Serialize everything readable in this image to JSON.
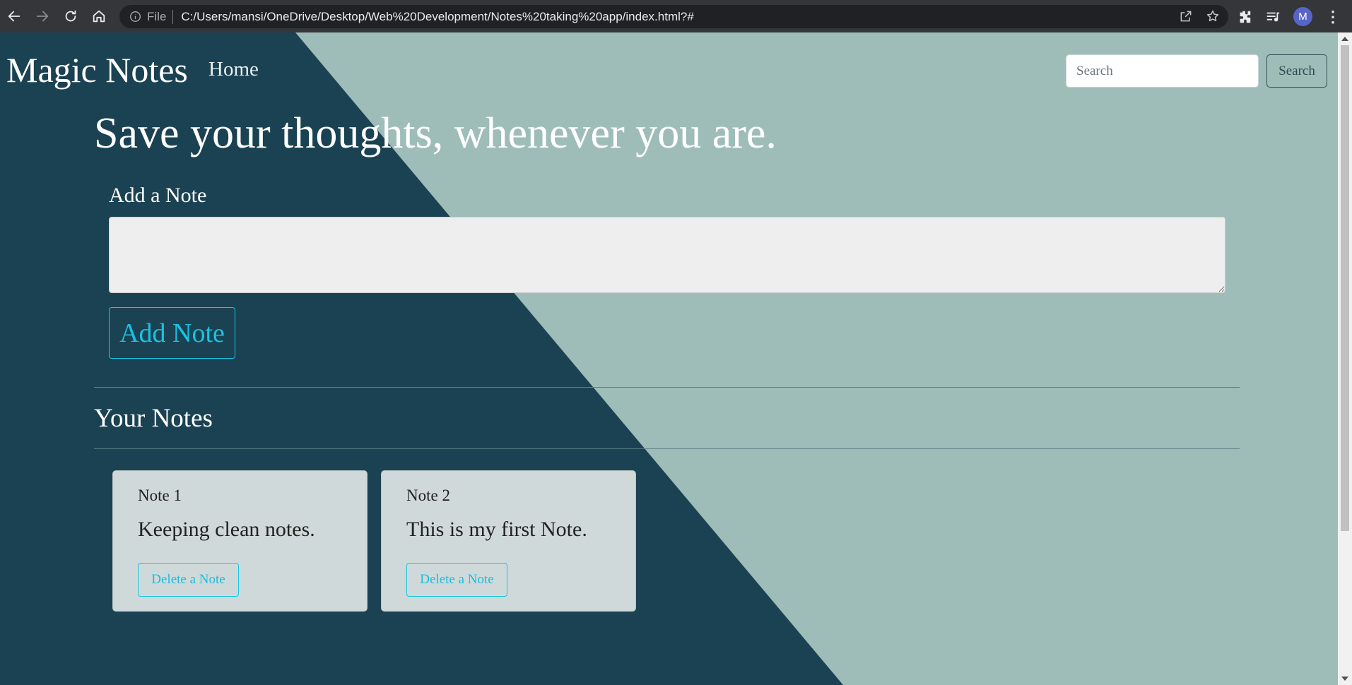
{
  "browser": {
    "file_label": "File",
    "url": "C:/Users/mansi/OneDrive/Desktop/Web%20Development/Notes%20taking%20app/index.html?#",
    "profile_initial": "M"
  },
  "nav": {
    "brand": "Magic Notes",
    "home": "Home",
    "search_placeholder": "Search",
    "search_button": "Search"
  },
  "main": {
    "headline": "Save your thoughts, whenever you are.",
    "add_label": "Add a Note",
    "add_button": "Add Note",
    "notes_heading": "Your Notes"
  },
  "notes": [
    {
      "title": "Note 1",
      "text": "Keeping clean notes.",
      "delete_label": "Delete a Note"
    },
    {
      "title": "Note 2",
      "text": "This is my first Note.",
      "delete_label": "Delete a Note"
    }
  ],
  "colors": {
    "dark_bg": "#1b4252",
    "light_bg": "#9ebdb8",
    "accent": "#19c3e3",
    "card_bg": "#d0d9d9"
  }
}
